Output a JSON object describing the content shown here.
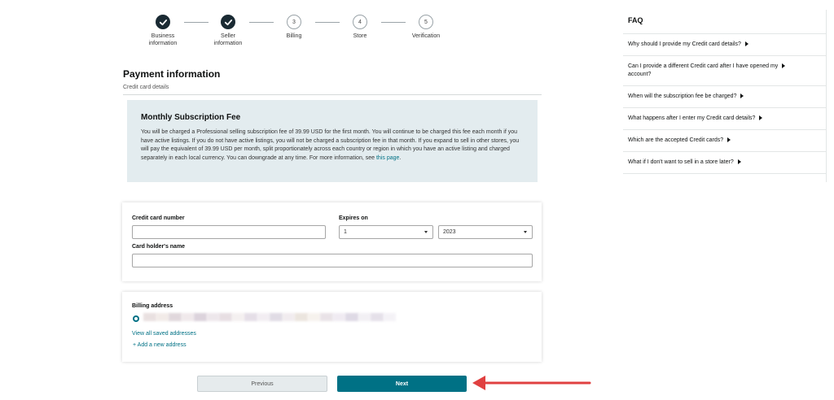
{
  "stepper": {
    "steps": [
      {
        "number": "",
        "label_line1": "Business",
        "label_line2": "information",
        "state": "done"
      },
      {
        "number": "",
        "label_line1": "Seller",
        "label_line2": "information",
        "state": "done"
      },
      {
        "number": "3",
        "label_line1": "Billing",
        "label_line2": "",
        "state": "current"
      },
      {
        "number": "4",
        "label_line1": "Store",
        "label_line2": "",
        "state": "todo"
      },
      {
        "number": "5",
        "label_line1": "Verification",
        "label_line2": "",
        "state": "todo"
      }
    ]
  },
  "page": {
    "title": "Payment information",
    "subtitle": "Credit card details"
  },
  "notice": {
    "heading": "Monthly Subscription Fee",
    "body": "You will be charged a Professional selling subscription fee of 39.99 USD for the first month. You will continue to be charged this fee each month if you have active listings. If you do not have active listings, you will not be charged a subscription fee in that month. If you expand to sell in other stores, you will pay the equivalent of 39.99 USD per month, split proportionately across each country or region in which you have an active listing and charged separately in each local currency. You can downgrade at any time. For more information, see",
    "link_text": "this page",
    "end": "."
  },
  "card_form": {
    "number_label": "Credit card number",
    "number_value": "",
    "expires_label": "Expires on",
    "month_value": "1",
    "year_value": "2023",
    "holder_label": "Card holder's name",
    "holder_value": ""
  },
  "billing": {
    "label": "Billing address",
    "view_all": "View all saved addresses",
    "add_new": "+ Add a new address"
  },
  "buttons": {
    "previous": "Previous",
    "next": "Next"
  },
  "faq": {
    "title": "FAQ",
    "items": [
      {
        "line1": "Why should I provide my Credit card details?",
        "line2": ""
      },
      {
        "line1": "Can I provide a different Credit card after I have opened my",
        "line2": "account?"
      },
      {
        "line1": "When will the subscription fee be charged?",
        "line2": ""
      },
      {
        "line1": "What happens after I enter my Credit card details?",
        "line2": ""
      },
      {
        "line1": "Which are the accepted Credit cards?",
        "line2": ""
      },
      {
        "line1": "What if I don't want to sell in a store later?",
        "line2": ""
      }
    ]
  },
  "colors": {
    "accent": "#007185",
    "step_done": "#1a2a33",
    "notice_bg": "#e3ecef",
    "arrow": "#e04040"
  }
}
